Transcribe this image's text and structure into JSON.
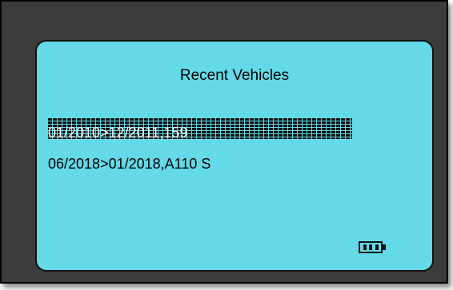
{
  "screen": {
    "title": "Recent Vehicles",
    "vehicles": [
      {
        "label": "01/2010>12/2011,159",
        "selected": true
      },
      {
        "label": "06/2018>01/2018,A110 S",
        "selected": false
      }
    ],
    "battery": {
      "level": 1.0
    }
  },
  "colors": {
    "lcd_background": "#64d9e8",
    "device_frame": "#3c3c3c",
    "text": "#000000",
    "selected_text": "#ffffff"
  }
}
